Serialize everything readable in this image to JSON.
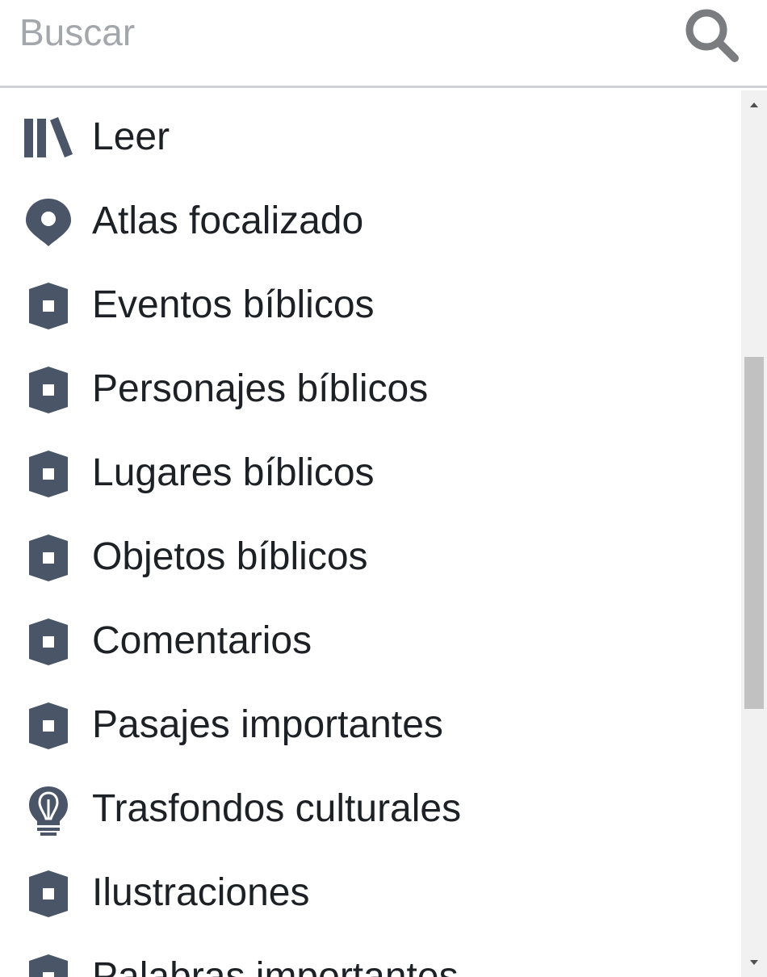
{
  "search": {
    "placeholder": "Buscar",
    "value": "",
    "icon": "search-icon"
  },
  "menu": {
    "items": [
      {
        "label": "Leer",
        "icon": "library-icon"
      },
      {
        "label": "Atlas focalizado",
        "icon": "map-pin-icon"
      },
      {
        "label": "Eventos bíblicos",
        "icon": "hexagon-tag-icon"
      },
      {
        "label": "Personajes bíblicos",
        "icon": "hexagon-tag-icon"
      },
      {
        "label": "Lugares bíblicos",
        "icon": "hexagon-tag-icon"
      },
      {
        "label": "Objetos bíblicos",
        "icon": "hexagon-tag-icon"
      },
      {
        "label": "Comentarios",
        "icon": "hexagon-tag-icon"
      },
      {
        "label": "Pasajes importantes",
        "icon": "hexagon-tag-icon"
      },
      {
        "label": "Trasfondos culturales",
        "icon": "lightbulb-icon"
      },
      {
        "label": "Ilustraciones",
        "icon": "hexagon-tag-icon"
      },
      {
        "label": "Palabras importantes",
        "icon": "hexagon-tag-icon"
      }
    ]
  },
  "colors": {
    "icon": "#4a5568",
    "text": "#1d2126",
    "placeholder": "#a3a6aa",
    "divider": "#cfd1d4",
    "scrollbar_track": "#f1f1f1",
    "scrollbar_thumb": "#c1c1c1"
  }
}
